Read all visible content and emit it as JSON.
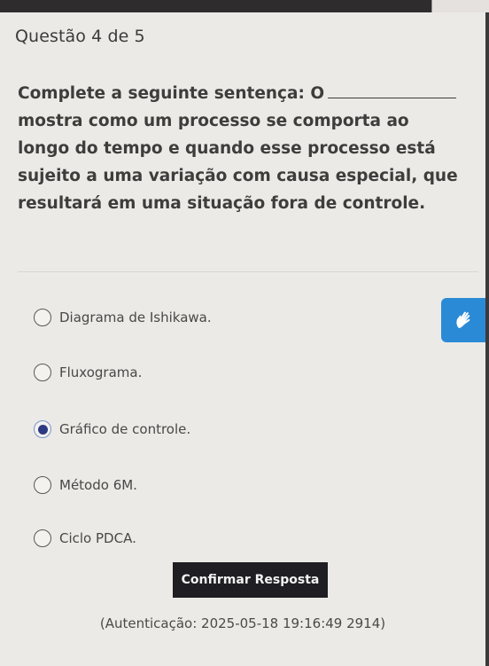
{
  "question": {
    "title": "Questão 4 de 5",
    "text_lines": [
      "Complete a seguinte sentença: O",
      "mostra como um processo se comporta ao",
      "longo do tempo e quando esse processo está",
      "sujeito a uma variação com causa especial, que",
      "resultará em uma situação fora de controle."
    ]
  },
  "options": [
    {
      "label": "Diagrama de Ishikawa.",
      "selected": false
    },
    {
      "label": "Fluxograma.",
      "selected": false
    },
    {
      "label": "Gráfico de controle.",
      "selected": true
    },
    {
      "label": "Método 6M.",
      "selected": false
    },
    {
      "label": "Ciclo PDCA.",
      "selected": false
    }
  ],
  "helper_button": {
    "icon": "sign-language-icon",
    "color": "#2a8ad6"
  },
  "confirm_button": {
    "label": "Confirmar Resposta"
  },
  "authentication": "(Autenticação: 2025-05-18 19:16:49 2914)",
  "colors": {
    "selected_radio": "#2b3a80",
    "confirm_bg": "#1f1e22"
  }
}
